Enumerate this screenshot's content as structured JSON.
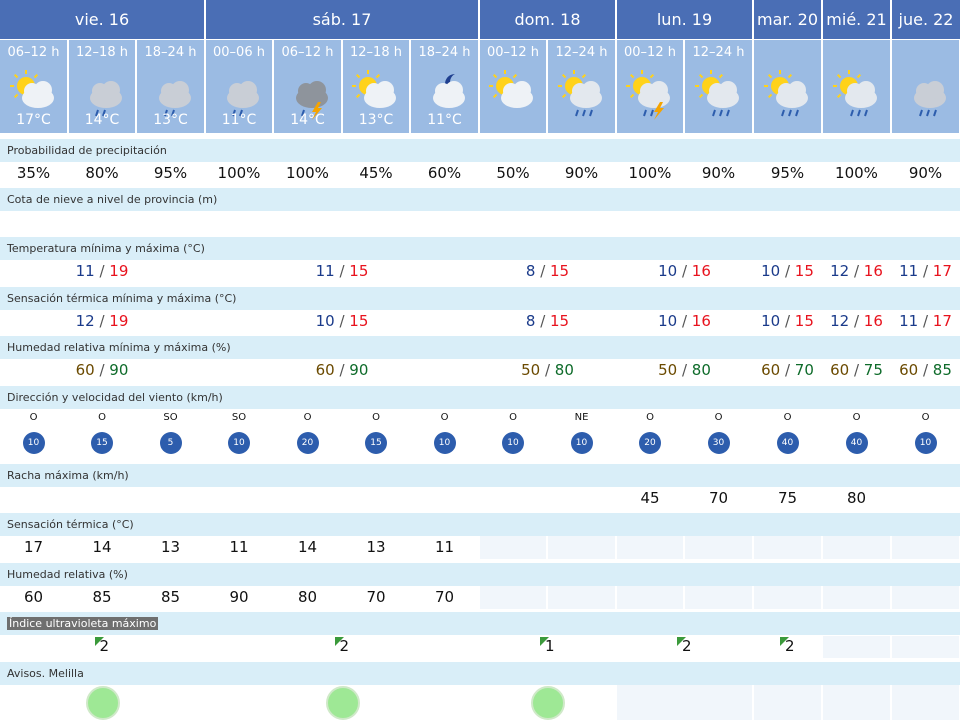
{
  "days": [
    {
      "label": "vie. 16"
    },
    {
      "label": "sáb. 17"
    },
    {
      "label": "dom. 18"
    },
    {
      "label": "lun. 19"
    },
    {
      "label": "mar. 20"
    },
    {
      "label": "mié. 21"
    },
    {
      "label": "jue. 22"
    }
  ],
  "periods": [
    {
      "label": "06–12 h",
      "temp": "17°C",
      "icon": "sun-cloud-icon"
    },
    {
      "label": "12–18 h",
      "temp": "14°C",
      "icon": "storm-rain-icon"
    },
    {
      "label": "18–24 h",
      "temp": "13°C",
      "icon": "storm-rain-icon"
    },
    {
      "label": "00–06 h",
      "temp": "11°C",
      "icon": "storm-rain-icon"
    },
    {
      "label": "06–12 h",
      "temp": "14°C",
      "icon": "storm-dark-icon"
    },
    {
      "label": "12–18 h",
      "temp": "13°C",
      "icon": "sun-cloud-icon"
    },
    {
      "label": "18–24 h",
      "temp": "11°C",
      "icon": "moon-cloud-icon"
    },
    {
      "label": "00–12 h",
      "temp": "",
      "icon": "sun-cloud-icon"
    },
    {
      "label": "12–24 h",
      "temp": "",
      "icon": "sun-rain-icon"
    },
    {
      "label": "00–12 h",
      "temp": "",
      "icon": "sun-storm-icon"
    },
    {
      "label": "12–24 h",
      "temp": "",
      "icon": "sun-rain-icon"
    },
    {
      "label": "",
      "temp": "",
      "icon": "sun-rain-icon"
    },
    {
      "label": "",
      "temp": "",
      "icon": "sun-rain-icon"
    },
    {
      "label": "",
      "temp": "",
      "icon": "cloud-rain-icon"
    }
  ],
  "labels": {
    "precip": "Probabilidad de precipitación",
    "snow": "Cota de nieve a nivel de provincia (m)",
    "temp": "Temperatura mínima y máxima (°C)",
    "feels": "Sensación térmica mínima y máxima (°C)",
    "hum": "Humedad relativa mínima y máxima (%)",
    "wind": "Dirección y velocidad del viento (km/h)",
    "gust": "Racha máxima (km/h)",
    "feels_t": "Sensación térmica (°C)",
    "hum_r": "Humedad relativa (%)",
    "uv": "Índice ultravioleta máximo",
    "warn": "Avisos. Melilla"
  },
  "precip": [
    "35%",
    "80%",
    "95%",
    "100%",
    "100%",
    "45%",
    "60%",
    "50%",
    "90%",
    "100%",
    "90%",
    "95%",
    "100%",
    "90%"
  ],
  "temp_minmax": [
    {
      "min": "11",
      "max": "19"
    },
    {
      "min": "11",
      "max": "15"
    },
    {
      "min": "8",
      "max": "15"
    },
    {
      "min": "10",
      "max": "16"
    },
    {
      "min": "10",
      "max": "15"
    },
    {
      "min": "12",
      "max": "16"
    },
    {
      "min": "11",
      "max": "17"
    }
  ],
  "feels_minmax": [
    {
      "min": "12",
      "max": "19"
    },
    {
      "min": "10",
      "max": "15"
    },
    {
      "min": "8",
      "max": "15"
    },
    {
      "min": "10",
      "max": "16"
    },
    {
      "min": "10",
      "max": "15"
    },
    {
      "min": "12",
      "max": "16"
    },
    {
      "min": "11",
      "max": "17"
    }
  ],
  "hum_minmax": [
    {
      "min": "60",
      "max": "90"
    },
    {
      "min": "60",
      "max": "90"
    },
    {
      "min": "50",
      "max": "80"
    },
    {
      "min": "50",
      "max": "80"
    },
    {
      "min": "60",
      "max": "70"
    },
    {
      "min": "60",
      "max": "75"
    },
    {
      "min": "60",
      "max": "85"
    }
  ],
  "wind": [
    {
      "dir": "O",
      "speed": "10"
    },
    {
      "dir": "O",
      "speed": "15"
    },
    {
      "dir": "SO",
      "speed": "5"
    },
    {
      "dir": "SO",
      "speed": "10"
    },
    {
      "dir": "O",
      "speed": "20"
    },
    {
      "dir": "O",
      "speed": "15"
    },
    {
      "dir": "O",
      "speed": "10"
    },
    {
      "dir": "O",
      "speed": "10"
    },
    {
      "dir": "NE",
      "speed": "10"
    },
    {
      "dir": "O",
      "speed": "20"
    },
    {
      "dir": "O",
      "speed": "30"
    },
    {
      "dir": "O",
      "speed": "40"
    },
    {
      "dir": "O",
      "speed": "40"
    },
    {
      "dir": "O",
      "speed": "10"
    }
  ],
  "gust": [
    "",
    "",
    "",
    "",
    "",
    "",
    "",
    "",
    "",
    "45",
    "70",
    "75",
    "80",
    ""
  ],
  "feels_t": [
    "17",
    "14",
    "13",
    "11",
    "14",
    "13",
    "11",
    "",
    "",
    "",
    "",
    "",
    "",
    ""
  ],
  "hum_r": [
    "60",
    "85",
    "85",
    "90",
    "80",
    "70",
    "70",
    "",
    "",
    "",
    "",
    "",
    "",
    ""
  ],
  "uv": [
    "2",
    "2",
    "1",
    "2",
    "2",
    "",
    ""
  ],
  "colors": {
    "header": "#4a6eb5",
    "period": "#9bbbe3",
    "label_row": "#d9eef8",
    "min": "#1a3a8a",
    "max": "#e8121d",
    "warn_green": "#9ee895"
  }
}
